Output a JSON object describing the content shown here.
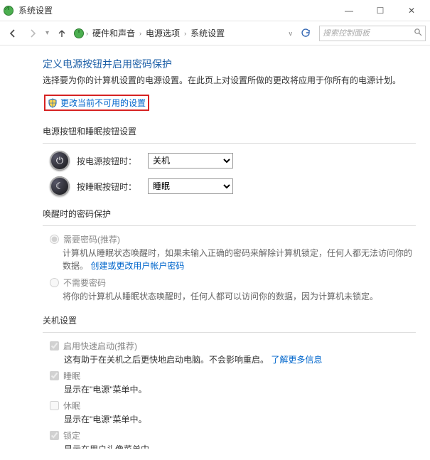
{
  "window": {
    "title": "系统设置"
  },
  "win_buttons": {
    "min": "—",
    "max": "☐",
    "close": "✕"
  },
  "breadcrumb": {
    "items": [
      "硬件和声音",
      "电源选项",
      "系统设置"
    ]
  },
  "search": {
    "placeholder": "搜索控制面板"
  },
  "page": {
    "heading": "定义电源按钮并启用密码保护",
    "desc": "选择要为你的计算机设置的电源设置。在此页上对设置所做的更改将应用于你所有的电源计划。",
    "unlock_link": "更改当前不可用的设置"
  },
  "buttons_section": {
    "title": "电源按钮和睡眠按钮设置",
    "power_label": "按电源按钮时：",
    "power_value": "关机",
    "sleep_label": "按睡眠按钮时：",
    "sleep_value": "睡眠"
  },
  "wake_section": {
    "title": "唤醒时的密码保护",
    "need_label": "需要密码(推荐)",
    "need_desc_prefix": "计算机从睡眠状态唤醒时，如果未输入正确的密码来解除计算机锁定，任何人都无法访问你的数据。",
    "need_link": "创建或更改用户帐户密码",
    "noneed_label": "不需要密码",
    "noneed_desc": "将你的计算机从睡眠状态唤醒时，任何人都可以访问你的数据，因为计算机未锁定。"
  },
  "shutdown_section": {
    "title": "关机设置",
    "fast_label": "启用快速启动(推荐)",
    "fast_desc": "这有助于在关机之后更快地启动电脑。不会影响重启。",
    "fast_link": "了解更多信息",
    "sleep_label": "睡眠",
    "sleep_desc": "显示在\"电源\"菜单中。",
    "hib_label": "休眠",
    "hib_desc": "显示在\"电源\"菜单中。",
    "lock_label": "锁定",
    "lock_desc": "显示在用户头像菜单中。"
  }
}
